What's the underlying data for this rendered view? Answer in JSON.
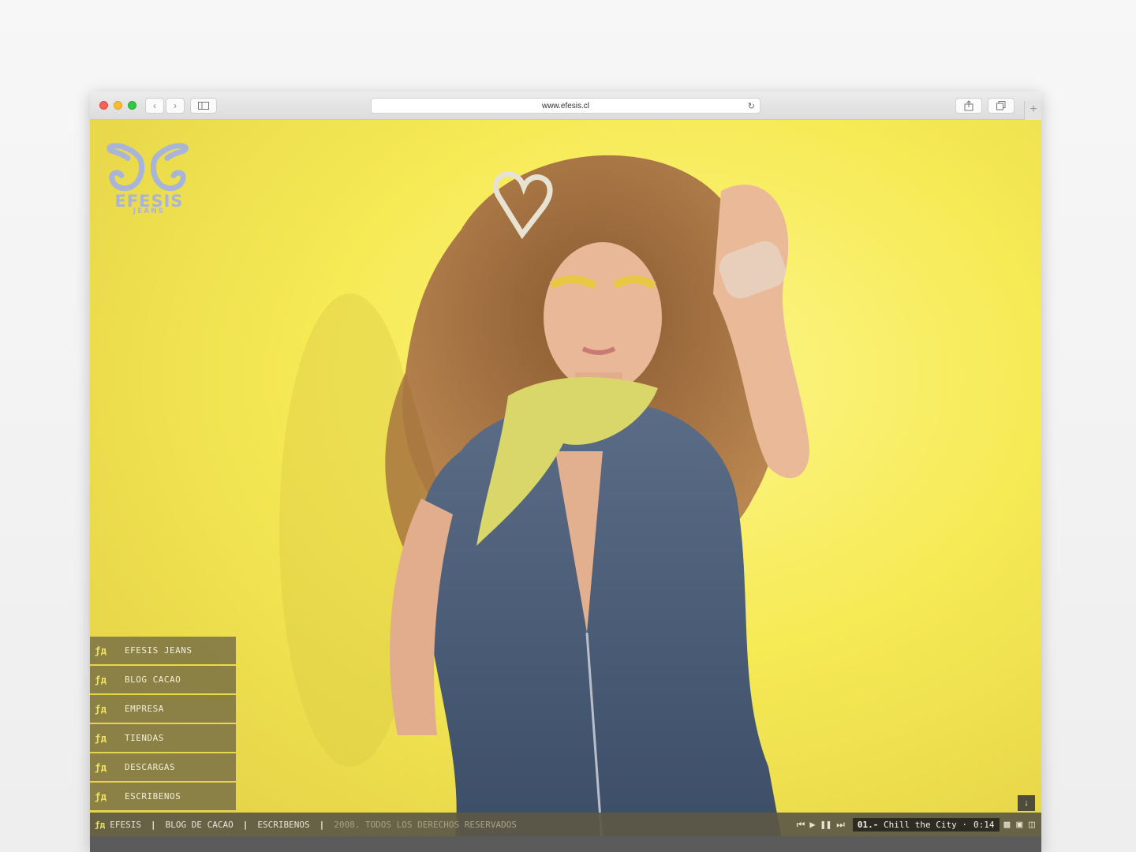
{
  "browser": {
    "url": "www.efesis.cl"
  },
  "brand": {
    "logo_text": "EFESIS",
    "logo_sub": "JEANS",
    "logo_color": "#a9b4d9"
  },
  "menu": {
    "items": [
      {
        "icon": "butterfly-icon",
        "label": "EFESIS JEANS"
      },
      {
        "icon": "butterfly-icon",
        "label": "BLOG CACAO"
      },
      {
        "icon": "butterfly-icon",
        "label": "EMPRESA"
      },
      {
        "icon": "butterfly-icon",
        "label": "TIENDAS"
      },
      {
        "icon": "butterfly-icon",
        "label": "DESCARGAS"
      },
      {
        "icon": "butterfly-icon",
        "label": "ESCRIBENOS"
      }
    ]
  },
  "footer": {
    "link1": "EFESIS",
    "link2": "BLOG DE CACAO",
    "link3": "ESCRIBENOS",
    "sep": "|",
    "copyright": "2008. TODOS LOS DERECHOS RESERVADOS"
  },
  "player": {
    "track_number": "01.-",
    "track_title": "Chill the City",
    "track_dot": "·",
    "time": "0:14"
  },
  "colors": {
    "background_yellow": "#f7ec58",
    "menu_bg": "#766c44",
    "accent": "#efe15c"
  }
}
